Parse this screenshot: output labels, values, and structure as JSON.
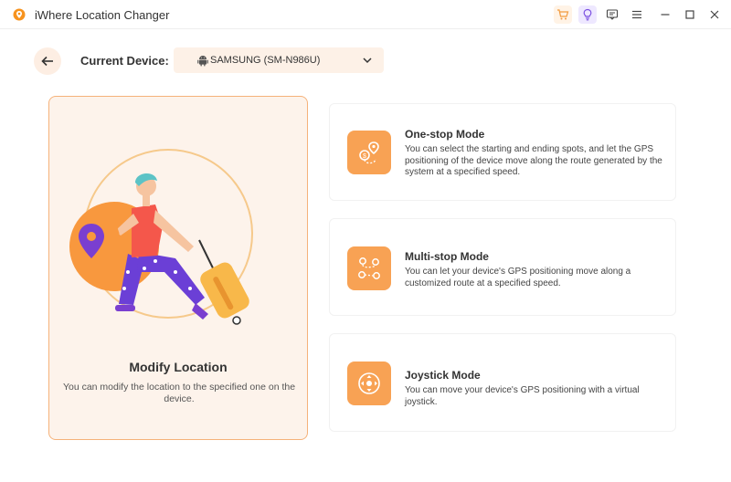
{
  "window": {
    "title": "iWhere Location Changer"
  },
  "titlebar": {
    "icons": [
      "cart-icon",
      "bulb-icon",
      "feedback-icon",
      "menu-icon",
      "minimize-icon",
      "maximize-icon",
      "close-icon"
    ]
  },
  "device": {
    "label": "Current Device:",
    "selected": "SAMSUNG (SM-N986U)"
  },
  "main_card": {
    "title": "Modify Location",
    "description": "You can modify the location to the specified one on the device."
  },
  "modes": [
    {
      "title": "One-stop Mode",
      "description": "You can select the starting and ending spots, and let the GPS positioning of the device move along the route generated by the system at a specified speed.",
      "icon": "one-stop-route-icon"
    },
    {
      "title": "Multi-stop Mode",
      "description": "You can let your device's GPS positioning move along a customized route at a specified speed.",
      "icon": "multi-stop-route-icon"
    },
    {
      "title": "Joystick Mode",
      "description": "You can move your device's GPS positioning with a virtual joystick.",
      "icon": "joystick-icon"
    }
  ],
  "colors": {
    "accent": "#f8a254",
    "card_bg": "#fdf3eb",
    "card_border": "#f5b27a",
    "purple": "#6b3fd6"
  }
}
